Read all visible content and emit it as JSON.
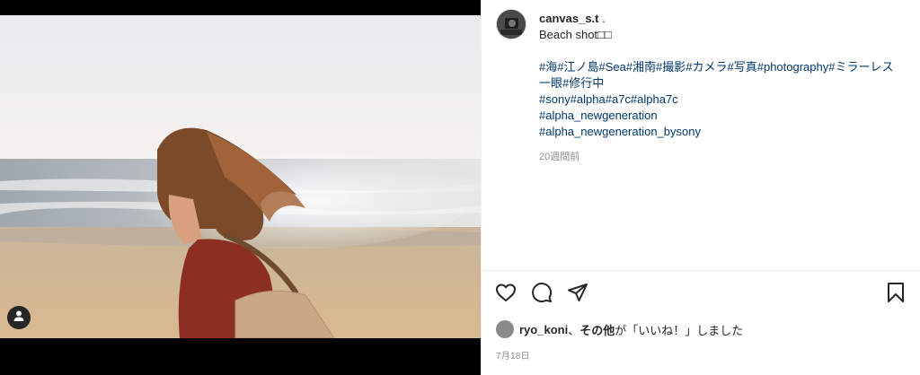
{
  "post": {
    "username": "canvas_s.t",
    "username_suffix": " .",
    "caption": "Beach shot□□",
    "hashtag_lines": [
      "#海#江ノ島#Sea#湘南#撮影#カメラ#写真#photography#ミラーレス一眼#修行中",
      "#sony#alpha#a7c#alpha7c",
      "#alpha_newgeneration",
      "#alpha_newgeneration_bysony"
    ],
    "time_ago": "20週間前"
  },
  "likes": {
    "liker": "ryo_koni",
    "separator": "、",
    "others": "その他",
    "suffix": "が「いいね！」しました"
  },
  "date": "7月18日",
  "icons": {
    "like": "heart-icon",
    "comment": "comment-bubble-icon",
    "share": "paper-plane-icon",
    "save": "bookmark-icon",
    "tagged": "user-icon"
  },
  "colors": {
    "hashtag": "#00376b",
    "muted": "#8e8e8e",
    "text": "#262626"
  }
}
